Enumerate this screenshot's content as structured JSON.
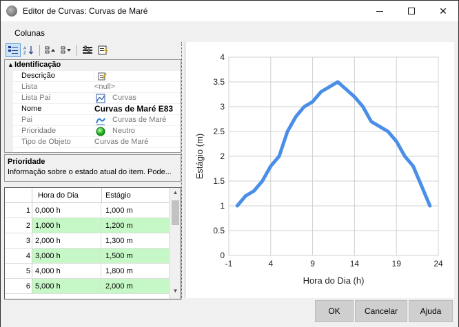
{
  "window": {
    "title": "Editor de Curvas: Curvas de Maré"
  },
  "menu": {
    "items": [
      "Colunas"
    ]
  },
  "propgrid": {
    "category": "Identificação",
    "rows": [
      {
        "name": "Descrição",
        "value": ""
      },
      {
        "name": "Lista",
        "value": "<null>"
      },
      {
        "name": "Lista Pai",
        "value": "Curvas"
      },
      {
        "name": "Nome",
        "value": "Curvas de Maré E83"
      },
      {
        "name": "Pai",
        "value": "Curvas de Maré"
      },
      {
        "name": "Prioridade",
        "value": "Neutro"
      },
      {
        "name": "Tipo de Objeto",
        "value": "Curvas de Maré"
      }
    ]
  },
  "description": {
    "title": "Prioridade",
    "text": "Informação sobre o estado atual do item. Pode..."
  },
  "grid": {
    "headers": [
      "Hora do Dia",
      "Estágio"
    ],
    "rows": [
      {
        "num": "1",
        "hora": "0,000 h",
        "estagio": "1,000 m"
      },
      {
        "num": "2",
        "hora": "1,000 h",
        "estagio": "1,200 m"
      },
      {
        "num": "3",
        "hora": "2,000 h",
        "estagio": "1,300 m"
      },
      {
        "num": "4",
        "hora": "3,000 h",
        "estagio": "1,500 m"
      },
      {
        "num": "5",
        "hora": "4,000 h",
        "estagio": "1,800 m"
      },
      {
        "num": "6",
        "hora": "5,000 h",
        "estagio": "2,000 m"
      }
    ]
  },
  "buttons": {
    "ok": "OK",
    "cancel": "Cancelar",
    "help": "Ajuda"
  },
  "colors": {
    "series": "#4a8ee8",
    "alt_row": "#c6f7c6"
  },
  "chart_data": {
    "type": "line",
    "xlabel": "Hora do Dia (h)",
    "ylabel": "Estágio (m)",
    "xlim": [
      -1,
      24
    ],
    "ylim": [
      0,
      4
    ],
    "xticks": [
      "-1",
      "4",
      "9",
      "14",
      "19",
      "24"
    ],
    "yticks": [
      "0",
      "0.5",
      "1",
      "1.5",
      "2",
      "2.5",
      "3",
      "3.5",
      "4"
    ],
    "grid": true,
    "series": [
      {
        "x": [
          0,
          1,
          2,
          3,
          4,
          5,
          6,
          7,
          8,
          9,
          10,
          11,
          12,
          13,
          14,
          15,
          16,
          17,
          18,
          19,
          20,
          21,
          22,
          23
        ],
        "y": [
          1.0,
          1.2,
          1.3,
          1.5,
          1.8,
          2.0,
          2.5,
          2.8,
          3.0,
          3.1,
          3.3,
          3.4,
          3.5,
          3.35,
          3.2,
          3.0,
          2.7,
          2.6,
          2.5,
          2.3,
          2.0,
          1.8,
          1.4,
          1.0
        ]
      }
    ]
  }
}
